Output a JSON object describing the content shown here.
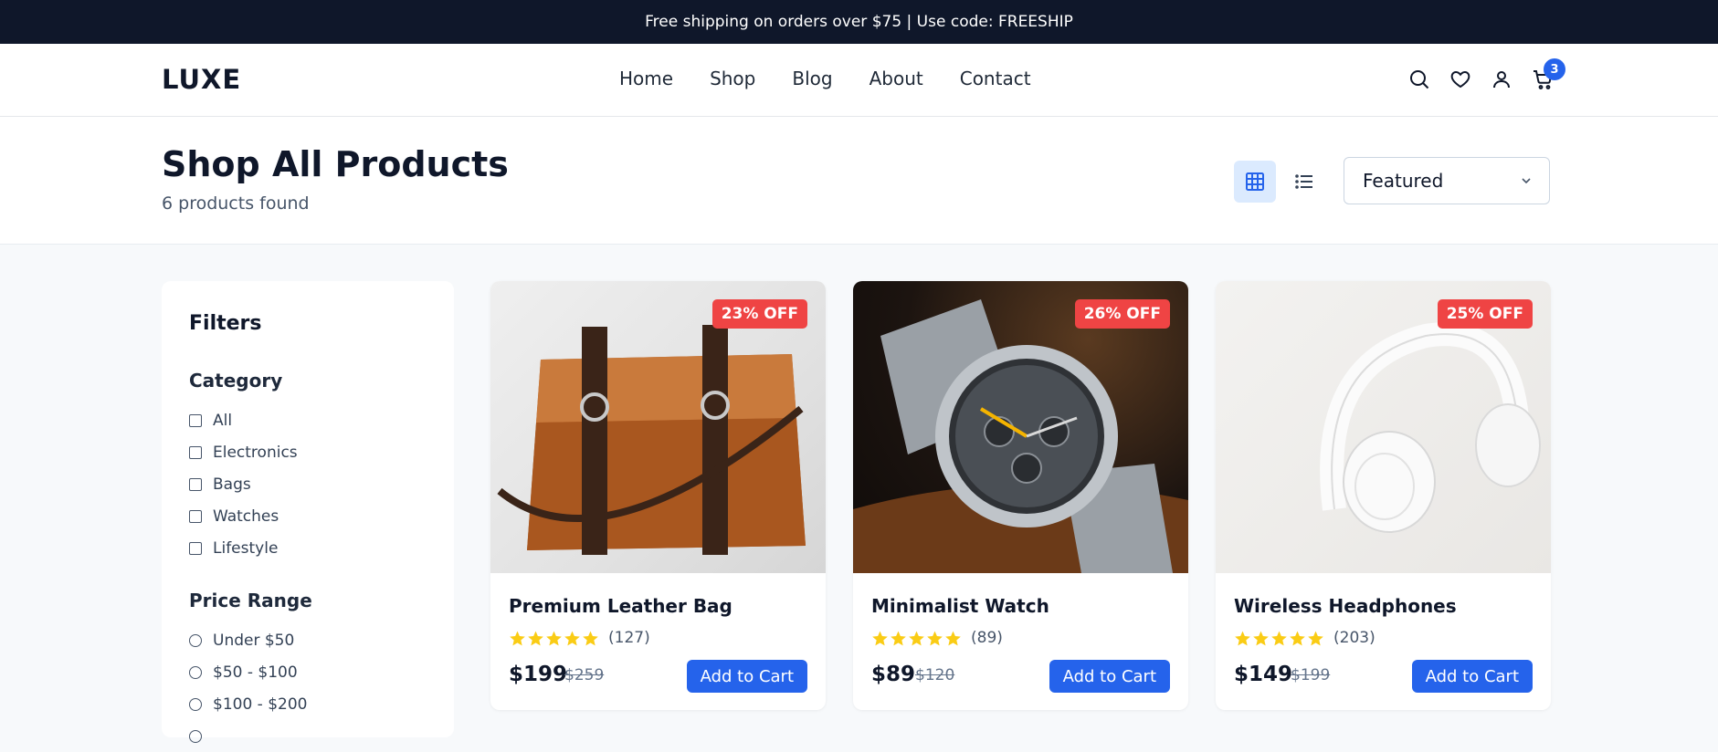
{
  "announcement": "Free shipping on orders over $75 | Use code: FREESHIP",
  "nav": {
    "logo": "LUXE",
    "links": [
      "Home",
      "Shop",
      "Blog",
      "About",
      "Contact"
    ],
    "icons": [
      "search-icon",
      "heart-icon",
      "user-icon",
      "cart-icon"
    ],
    "cart_count": "3"
  },
  "header": {
    "title": "Shop All Products",
    "count": "6 products found",
    "sort": "Featured"
  },
  "filters": {
    "title": "Filters",
    "category_title": "Category",
    "categories": [
      "All",
      "Electronics",
      "Bags",
      "Watches",
      "Lifestyle"
    ],
    "price_title": "Price Range",
    "prices": [
      "Under $50",
      "$50 - $100",
      "$100 - $200"
    ]
  },
  "products": [
    {
      "name": "Premium Leather Bag",
      "discount": "23% OFF",
      "reviews": "(127)",
      "price": "$199",
      "old_price": "$259",
      "button": "Add to Cart",
      "rating": 5
    },
    {
      "name": "Minimalist Watch",
      "discount": "26% OFF",
      "reviews": "(89)",
      "price": "$89",
      "old_price": "$120",
      "button": "Add to Cart",
      "rating": 5
    },
    {
      "name": "Wireless Headphones",
      "discount": "25% OFF",
      "reviews": "(203)",
      "price": "$149",
      "old_price": "$199",
      "button": "Add to Cart",
      "rating": 5
    }
  ],
  "colors": {
    "accent": "#2563eb",
    "discount": "#ef4444",
    "star": "#facc15",
    "dark": "#0f172a"
  }
}
